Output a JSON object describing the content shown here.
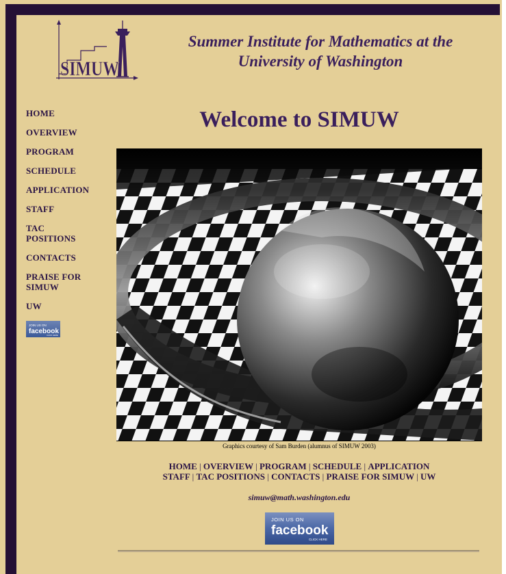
{
  "site": {
    "title_line1": "Summer Institute for Mathematics at the",
    "title_line2": "University of Washington",
    "logo_text": "SIMUW"
  },
  "sidebar": {
    "items": [
      {
        "label": "HOME"
      },
      {
        "label": "OVERVIEW"
      },
      {
        "label": "PROGRAM"
      },
      {
        "label": "SCHEDULE"
      },
      {
        "label": "APPLICATION"
      },
      {
        "label": "STAFF"
      },
      {
        "label": "TAC POSITIONS"
      },
      {
        "label": "CONTACTS"
      },
      {
        "label": "PRAISE FOR SIMUW"
      },
      {
        "label": "UW"
      }
    ],
    "facebook_badge": {
      "line1": "JOIN US ON",
      "line2": "facebook",
      "line3": "CLICK HERE"
    }
  },
  "main": {
    "heading": "Welcome to SIMUW",
    "caption": "Graphics courtesy of Sam Burden (alumnus of SIMUW 2003)",
    "footer_nav_row1": [
      "HOME",
      "OVERVIEW",
      "PROGRAM",
      "SCHEDULE",
      "APPLICATION"
    ],
    "footer_nav_row2": [
      "STAFF",
      "TAC POSITIONS",
      "CONTACTS",
      "PRAISE FOR SIMUW",
      "UW"
    ],
    "separator": "|",
    "email": "simuw@math.washington.edu",
    "facebook_button": {
      "line1": "JOIN US ON",
      "line2": "facebook",
      "line3": "CLICK HERE"
    }
  },
  "colors": {
    "background": "#e4cf97",
    "frame": "#241035",
    "heading": "#3a1f5c",
    "facebook": "#3b5998"
  }
}
